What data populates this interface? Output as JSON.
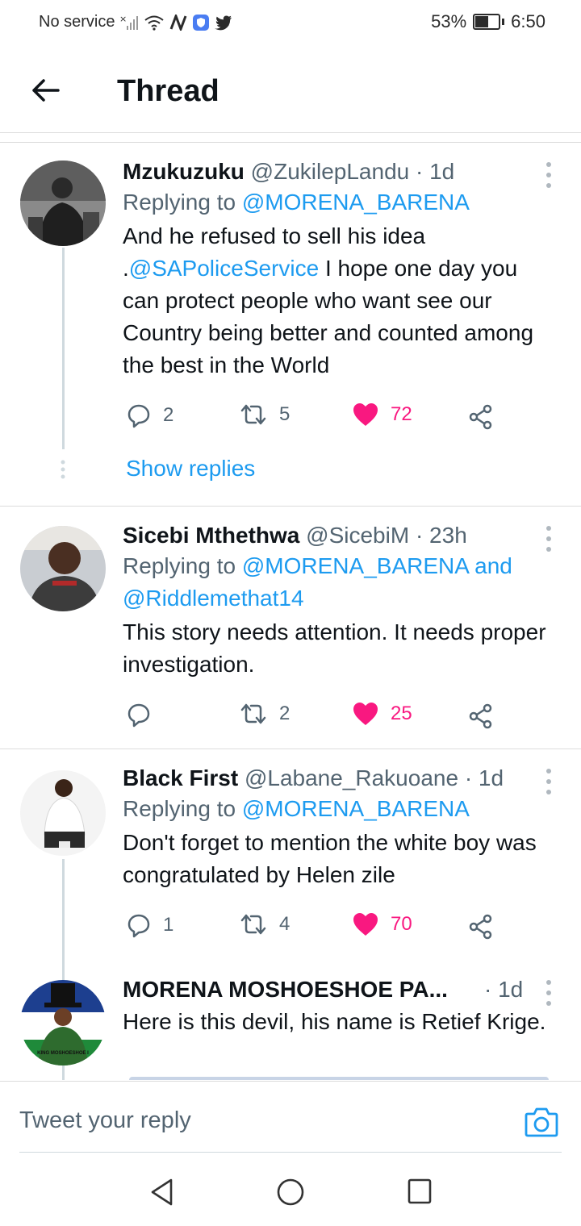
{
  "status_bar": {
    "carrier": "No service",
    "battery_pct": "53%",
    "time": "6:50"
  },
  "header": {
    "title": "Thread"
  },
  "tweets": [
    {
      "name": "Mzukuzuku",
      "handle": "@ZukilepLandu",
      "time": "· 1d",
      "replying_prefix": "Replying to",
      "replying_to": "@MORENA_BARENA",
      "text_before": "And he refused to sell his idea .",
      "text_mention": "@SAPoliceService",
      "text_after": " I hope one day you can protect people who want see our Country being better and counted among the best in the World",
      "replies": "2",
      "retweets": "5",
      "likes": "72",
      "show_replies": "Show replies"
    },
    {
      "name": "Sicebi Mthethwa",
      "handle": "@SicebiM",
      "time": "· 23h",
      "replying_prefix": "Replying to",
      "replying_to": "@MORENA_BARENA",
      "replying_and": "and",
      "replying_to_2": "@Riddlemethat14",
      "text": "This story needs attention. It needs proper investigation.",
      "replies": "",
      "retweets": "2",
      "likes": "25"
    },
    {
      "name": "Black First",
      "handle": "@Labane_Rakuoane",
      "time": "· 1d",
      "replying_prefix": "Replying to",
      "replying_to": "@MORENA_BARENA",
      "text": "Don't forget to mention the white boy was congratulated by Helen zile",
      "replies": "1",
      "retweets": "4",
      "likes": "70"
    },
    {
      "name": "MORENA MOSHOESHOE PA...",
      "time": "· 1d",
      "text": "Here is this devil, his name is Retief Krige.",
      "avatar_caption": "KING MOSHOESHOE I"
    }
  ],
  "compose": {
    "placeholder": "Tweet your reply"
  },
  "colors": {
    "accent": "#1d9bf0",
    "like": "#f91880",
    "muted": "#536471"
  }
}
